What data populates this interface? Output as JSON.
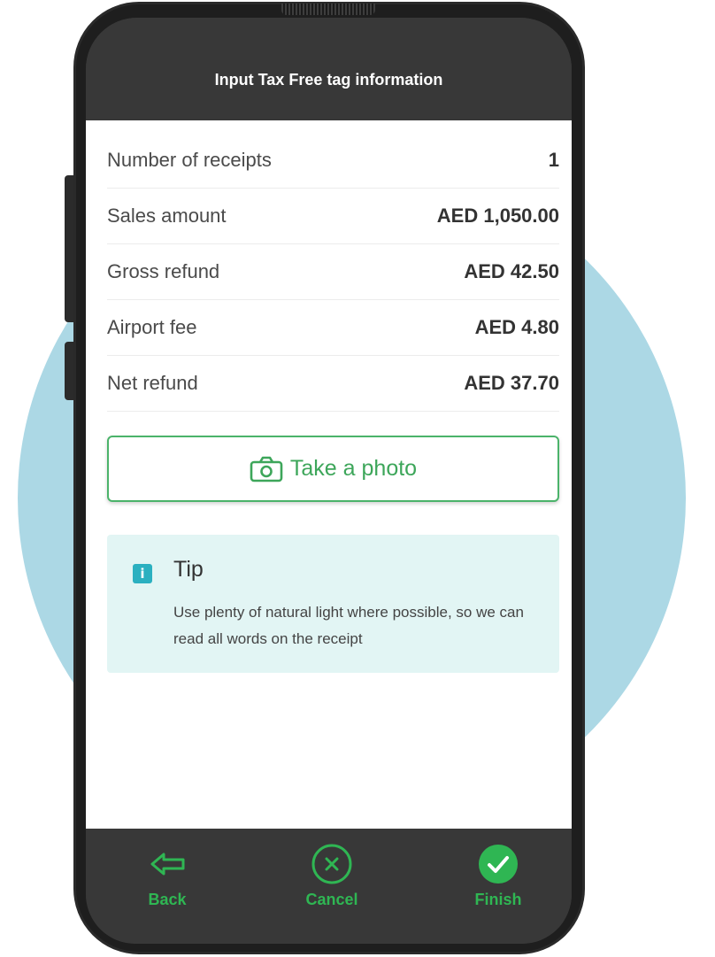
{
  "header": {
    "title": "Input Tax Free tag information"
  },
  "summary": {
    "rows": [
      {
        "label": "Number of receipts",
        "value": "1"
      },
      {
        "label": "Sales amount",
        "value": "AED 1,050.00"
      },
      {
        "label": "Gross refund",
        "value": "AED 42.50"
      },
      {
        "label": "Airport fee",
        "value": "AED 4.80"
      },
      {
        "label": "Net refund",
        "value": "AED 37.70"
      }
    ]
  },
  "photo_button": {
    "label": "Take a photo",
    "icon": "camera-icon"
  },
  "tip": {
    "icon": "info-icon",
    "icon_glyph": "i",
    "title": "Tip",
    "body": "Use plenty of natural light where possible, so we can read all words on the receipt"
  },
  "footer": {
    "back_label": "Back",
    "cancel_label": "Cancel",
    "finish_label": "Finish"
  },
  "colors": {
    "accent_green": "#2fb653",
    "bar_dark": "#383838",
    "tip_bg": "#e2f5f4",
    "info_teal": "#2bb0c0",
    "backdrop_circle": "#acd8e5"
  }
}
